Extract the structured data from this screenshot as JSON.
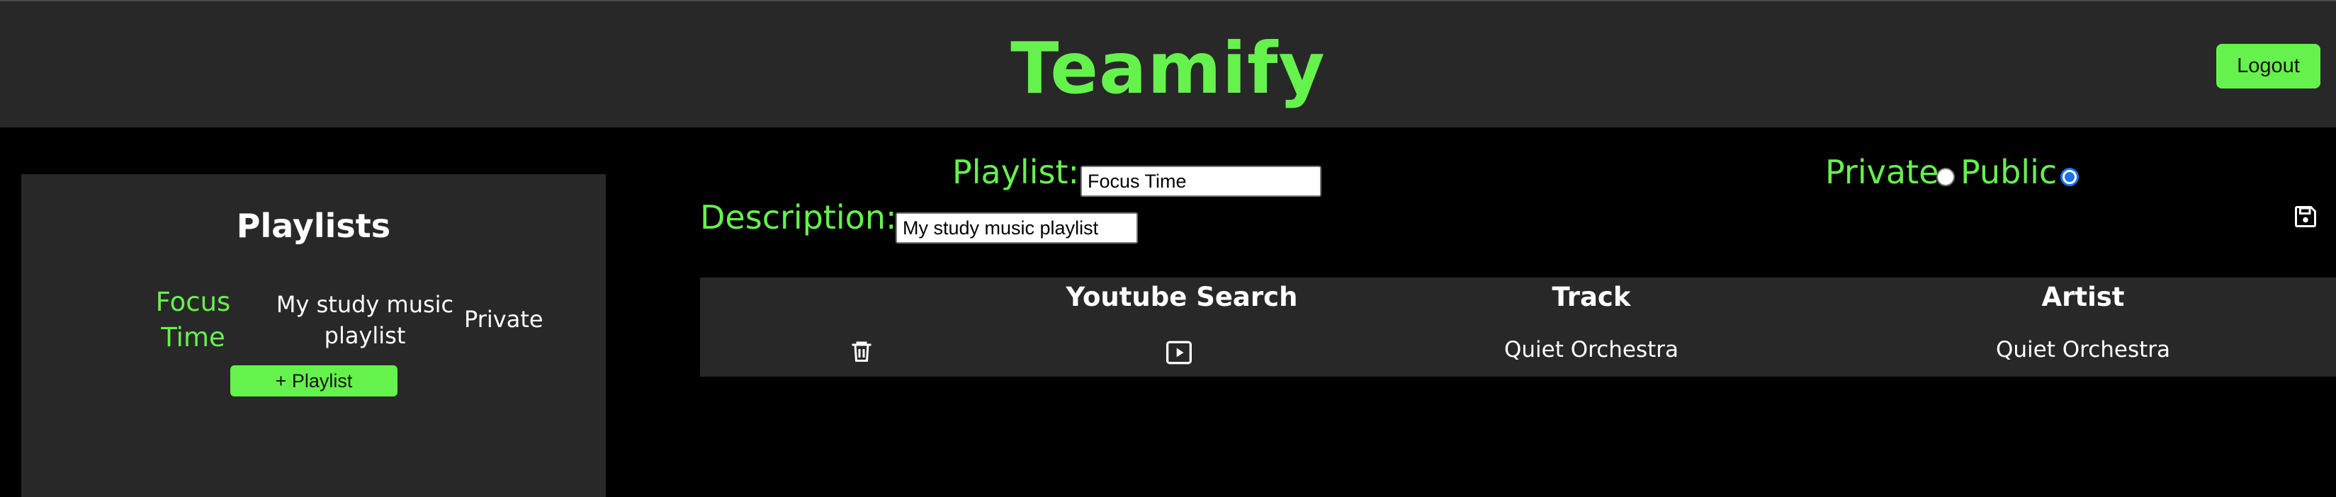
{
  "header": {
    "title": "Teamify",
    "logout_label": "Logout"
  },
  "sidebar": {
    "title": "Playlists",
    "playlists": [
      {
        "name": "Focus Time",
        "description": "My study music playlist",
        "visibility": "Private"
      }
    ],
    "add_playlist_label": "+ Playlist"
  },
  "editor": {
    "playlist_label": "Playlist:",
    "playlist_value": "Focus Time",
    "description_label": "Description:",
    "description_value": "My study music playlist",
    "private_label": "Private",
    "public_label": "Public",
    "visibility_selected": "Public",
    "save_icon": "floppy-disk-icon"
  },
  "tracks": {
    "columns": [
      "",
      "Youtube Search",
      "Track",
      "Artist"
    ],
    "rows": [
      {
        "delete_icon": "trash-icon",
        "youtube_icon": "play-icon",
        "track": "Quiet Orchestra",
        "artist": "Quiet Orchestra"
      }
    ]
  },
  "colors": {
    "accent": "#66f24d",
    "panel": "#282828",
    "background": "#000000"
  }
}
